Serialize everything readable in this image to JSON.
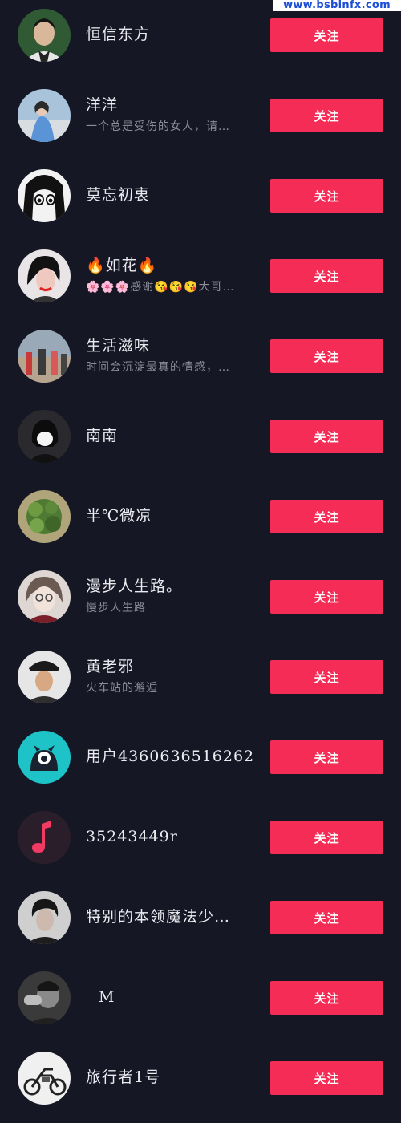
{
  "watermark": "www.bsbinfx.com",
  "accent_color": "#f42c56",
  "background_color": "#161724",
  "users": [
    {
      "name": "恒信东方",
      "desc": "",
      "follow_label": "关注"
    },
    {
      "name": "洋洋",
      "desc": "一个总是受伤的女人，请…",
      "follow_label": "关注"
    },
    {
      "name": "莫忘初衷",
      "desc": "",
      "follow_label": "关注"
    },
    {
      "name": "🔥如花🔥",
      "desc": "🌸🌸🌸感谢😘😘😘大哥…",
      "follow_label": "关注"
    },
    {
      "name": "生活滋味",
      "desc": "时间会沉淀最真的情感，…",
      "follow_label": "关注"
    },
    {
      "name": "南南",
      "desc": "",
      "follow_label": "关注"
    },
    {
      "name": "半℃微凉",
      "desc": "",
      "follow_label": "关注"
    },
    {
      "name": "漫步人生路。",
      "desc": "慢步人生路",
      "follow_label": "关注"
    },
    {
      "name": "黄老邪",
      "desc": "火车站的邂逅",
      "follow_label": "关注"
    },
    {
      "name": "用户4360636516262",
      "desc": "",
      "follow_label": "关注"
    },
    {
      "name": "35243449r",
      "desc": "",
      "follow_label": "关注"
    },
    {
      "name": "特别的本领魔法少…",
      "desc": "",
      "follow_label": "关注"
    },
    {
      "name": "M",
      "desc": "",
      "follow_label": "关注"
    },
    {
      "name": "旅行者1号",
      "desc": "",
      "follow_label": "关注"
    }
  ]
}
